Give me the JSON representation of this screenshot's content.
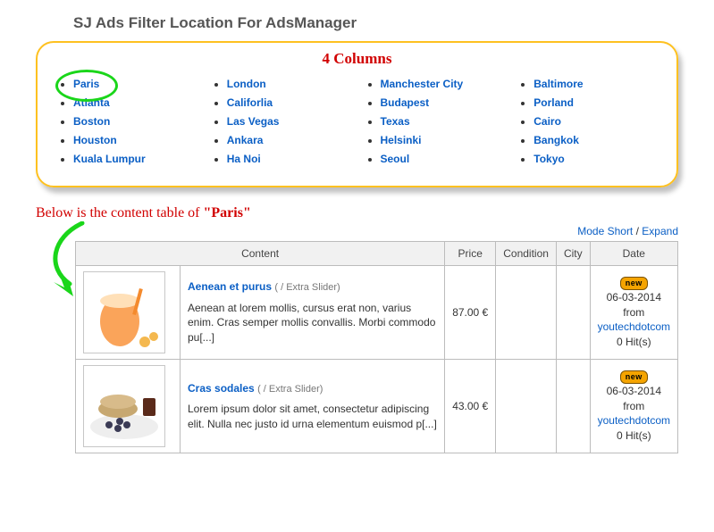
{
  "title": "SJ Ads Filter Location For AdsManager",
  "columns_label": "4 Columns",
  "highlighted_city": "Paris",
  "locations": {
    "col1": [
      "Paris",
      "Atlanta",
      "Boston",
      "Houston",
      "Kuala Lumpur"
    ],
    "col2": [
      "London",
      "Califorlia",
      "Las Vegas",
      "Ankara",
      "Ha Noi"
    ],
    "col3": [
      "Manchester City",
      "Budapest",
      "Texas",
      "Helsinki",
      "Seoul"
    ],
    "col4": [
      "Baltimore",
      "Porland",
      "Cairo",
      "Bangkok",
      "Tokyo"
    ]
  },
  "caption_prefix": "Below is the content table of ",
  "caption_city": "\"Paris\"",
  "mode": {
    "short": "Mode Short",
    "sep": " / ",
    "expand": "Expand"
  },
  "headers": {
    "content": "Content",
    "price": "Price",
    "condition": "Condition",
    "city": "City",
    "date": "Date"
  },
  "rows": [
    {
      "thumb": {
        "bg": "#fff",
        "accent": "#faa45a",
        "accent2": "#f48a2d"
      },
      "title": "Aenean et purus",
      "cat": "( / Extra Slider)",
      "desc": "Aenean at lorem mollis, cursus erat non, varius enim. Cras semper mollis convallis. Morbi commodo pu[...]",
      "price": "87.00 €",
      "condition": "",
      "city": "",
      "badge": "new",
      "date": "06-03-2014",
      "from": "from",
      "user": "youtechdotcom",
      "hits": "0 Hit(s)"
    },
    {
      "thumb": {
        "bg": "#fff",
        "accent": "#3b3b55",
        "accent2": "#c7a871"
      },
      "title": "Cras sodales",
      "cat": "( / Extra Slider)",
      "desc": "Lorem ipsum dolor sit amet, consectetur adipiscing elit. Nulla nec justo id urna elementum euismod p[...]",
      "price": "43.00 €",
      "condition": "",
      "city": "",
      "badge": "new",
      "date": "06-03-2014",
      "from": "from",
      "user": "youtechdotcom",
      "hits": "0 Hit(s)"
    }
  ]
}
